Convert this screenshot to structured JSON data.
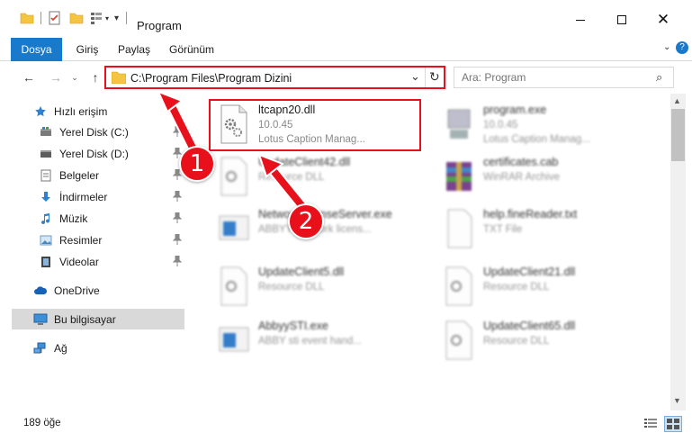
{
  "window": {
    "title": "Program",
    "controls": [
      "minimize-icon",
      "maximize-icon",
      "close-icon"
    ]
  },
  "ribbon": {
    "tabs": [
      "Dosya",
      "Giriş",
      "Paylaş",
      "Görünüm"
    ]
  },
  "address": {
    "path": "C:\\Program Files\\Program Dizini",
    "search_placeholder": "Ara: Program"
  },
  "sidebar": {
    "items": [
      {
        "label": "Hızlı erişim",
        "icon": "star-icon"
      },
      {
        "label": "Yerel Disk (C:)",
        "icon": "drive-icon",
        "pinned": true
      },
      {
        "label": "Yerel Disk (D:)",
        "icon": "drive-icon",
        "pinned": true
      },
      {
        "label": "Belgeler",
        "icon": "documents-icon",
        "pinned": true
      },
      {
        "label": "İndirmeler",
        "icon": "download-icon",
        "pinned": true
      },
      {
        "label": "Müzik",
        "icon": "music-icon",
        "pinned": true
      },
      {
        "label": "Resimler",
        "icon": "pictures-icon",
        "pinned": true
      },
      {
        "label": "Videolar",
        "icon": "video-icon",
        "pinned": true
      },
      {
        "label": "OneDrive",
        "icon": "cloud-icon"
      },
      {
        "label": "Bu bilgisayar",
        "icon": "computer-icon",
        "selected": true
      },
      {
        "label": "Ağ",
        "icon": "network-icon"
      }
    ]
  },
  "files": [
    {
      "name": "ltcapn20.dll",
      "line1": "10.0.45",
      "line2": "Lotus Caption Manag..."
    },
    {
      "name": "program.exe",
      "line1": "10.0.45",
      "line2": "Lotus Caption Manag..."
    },
    {
      "name": "UpdateClient42.dll",
      "line1": "Resource DLL",
      "line2": ""
    },
    {
      "name": "certificates.cab",
      "line1": "WinRAR Archive",
      "line2": ""
    },
    {
      "name": "NetworkLicenseServer.exe",
      "line1": "ABBYY Network licens...",
      "line2": ""
    },
    {
      "name": "help.fineReader.txt",
      "line1": "TXT File",
      "line2": ""
    },
    {
      "name": "UpdateClient5.dll",
      "line1": "Resource DLL",
      "line2": ""
    },
    {
      "name": "UpdateClient21.dll",
      "line1": "Resource DLL",
      "line2": ""
    },
    {
      "name": "AbbyySTI.exe",
      "line1": "ABBY sti event hand...",
      "line2": ""
    },
    {
      "name": "UpdateClient65.dll",
      "line1": "Resource DLL",
      "line2": ""
    }
  ],
  "status": {
    "count": "189 öğe"
  },
  "annotations": {
    "step1": "1",
    "step2": "2",
    "color": "#e8101a"
  },
  "colors": {
    "accent": "#1979ca",
    "highlight": "#e8101a",
    "selection": "#d9d9d9"
  }
}
